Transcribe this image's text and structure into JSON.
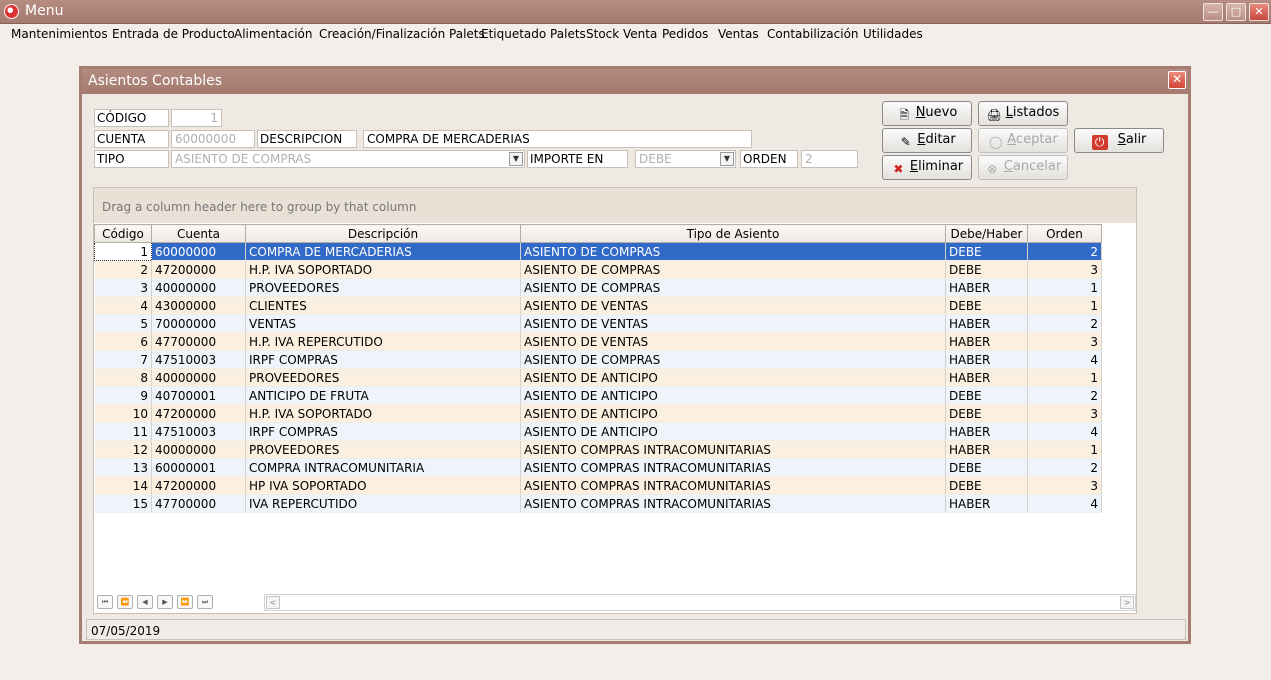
{
  "main_window": {
    "title": "Menu",
    "menu": [
      "Mantenimientos",
      "Entrada de Producto",
      "Alimentación",
      "Creación/Finalización Palets",
      "Etiquetado Palets",
      "Stock Venta",
      "Pedidos",
      "Ventas",
      "Contabilización",
      "Utilidades"
    ]
  },
  "dialog": {
    "title": "Asientos Contables",
    "form": {
      "codigo_label": "CÓDIGO",
      "codigo_value": "1",
      "cuenta_label": "CUENTA",
      "cuenta_value": "60000000",
      "descripcion_label": "DESCRIPCION",
      "descripcion_value": "COMPRA DE MERCADERIAS",
      "tipo_label": "TIPO",
      "tipo_value": "ASIENTO DE COMPRAS",
      "importe_label": "IMPORTE EN",
      "importe_value": "DEBE",
      "orden_label": "ORDEN",
      "orden_value": "2"
    },
    "buttons": {
      "nuevo_ul": "N",
      "nuevo_rest": "uevo",
      "listados_ul": "L",
      "listados_rest": "istados",
      "editar_ul": "E",
      "editar_rest": "ditar",
      "aceptar_ul": "A",
      "aceptar_rest": "ceptar",
      "salir_ul": "S",
      "salir_rest": "alir",
      "eliminar_ul": "E",
      "eliminar_rest": "liminar",
      "cancelar_ul": "C",
      "cancelar_rest": "ancelar"
    },
    "grid": {
      "group_hint": "Drag a column header here to group by that column",
      "columns": [
        "Código",
        "Cuenta",
        "Descripción",
        "Tipo de Asiento",
        "Debe/Haber",
        "Orden"
      ],
      "rows": [
        [
          "1",
          "60000000",
          "COMPRA DE MERCADERIAS",
          "ASIENTO DE COMPRAS",
          "DEBE",
          "2"
        ],
        [
          "2",
          "47200000",
          "H.P. IVA SOPORTADO",
          "ASIENTO DE COMPRAS",
          "DEBE",
          "3"
        ],
        [
          "3",
          "40000000",
          "PROVEEDORES",
          "ASIENTO DE COMPRAS",
          "HABER",
          "1"
        ],
        [
          "4",
          "43000000",
          "CLIENTES",
          "ASIENTO DE VENTAS",
          "DEBE",
          "1"
        ],
        [
          "5",
          "70000000",
          "VENTAS",
          "ASIENTO DE VENTAS",
          "HABER",
          "2"
        ],
        [
          "6",
          "47700000",
          "H.P. IVA REPERCUTIDO",
          "ASIENTO DE VENTAS",
          "HABER",
          "3"
        ],
        [
          "7",
          "47510003",
          "IRPF COMPRAS",
          "ASIENTO DE COMPRAS",
          "HABER",
          "4"
        ],
        [
          "8",
          "40000000",
          "PROVEEDORES",
          "ASIENTO DE ANTICIPO",
          "HABER",
          "1"
        ],
        [
          "9",
          "40700001",
          "ANTICIPO DE FRUTA",
          "ASIENTO DE ANTICIPO",
          "DEBE",
          "2"
        ],
        [
          "10",
          "47200000",
          "H.P. IVA SOPORTADO",
          "ASIENTO DE ANTICIPO",
          "DEBE",
          "3"
        ],
        [
          "11",
          "47510003",
          "IRPF COMPRAS",
          "ASIENTO DE ANTICIPO",
          "HABER",
          "4"
        ],
        [
          "12",
          "40000000",
          "PROVEEDORES",
          "ASIENTO COMPRAS INTRACOMUNITARIAS",
          "HABER",
          "1"
        ],
        [
          "13",
          "60000001",
          "COMPRA INTRACOMUNITARIA",
          "ASIENTO COMPRAS INTRACOMUNITARIAS",
          "DEBE",
          "2"
        ],
        [
          "14",
          "47200000",
          "HP IVA SOPORTADO",
          "ASIENTO COMPRAS INTRACOMUNITARIAS",
          "DEBE",
          "3"
        ],
        [
          "15",
          "47700000",
          "IVA REPERCUTIDO",
          "ASIENTO COMPRAS INTRACOMUNITARIAS",
          "HABER",
          "4"
        ]
      ],
      "selected_row": 0
    },
    "status": "07/05/2019"
  },
  "colors": {
    "title_bar": "#a67b70",
    "selection": "#3169c6",
    "row_even": "#eef4fa",
    "row_odd": "#fbf0e0"
  }
}
